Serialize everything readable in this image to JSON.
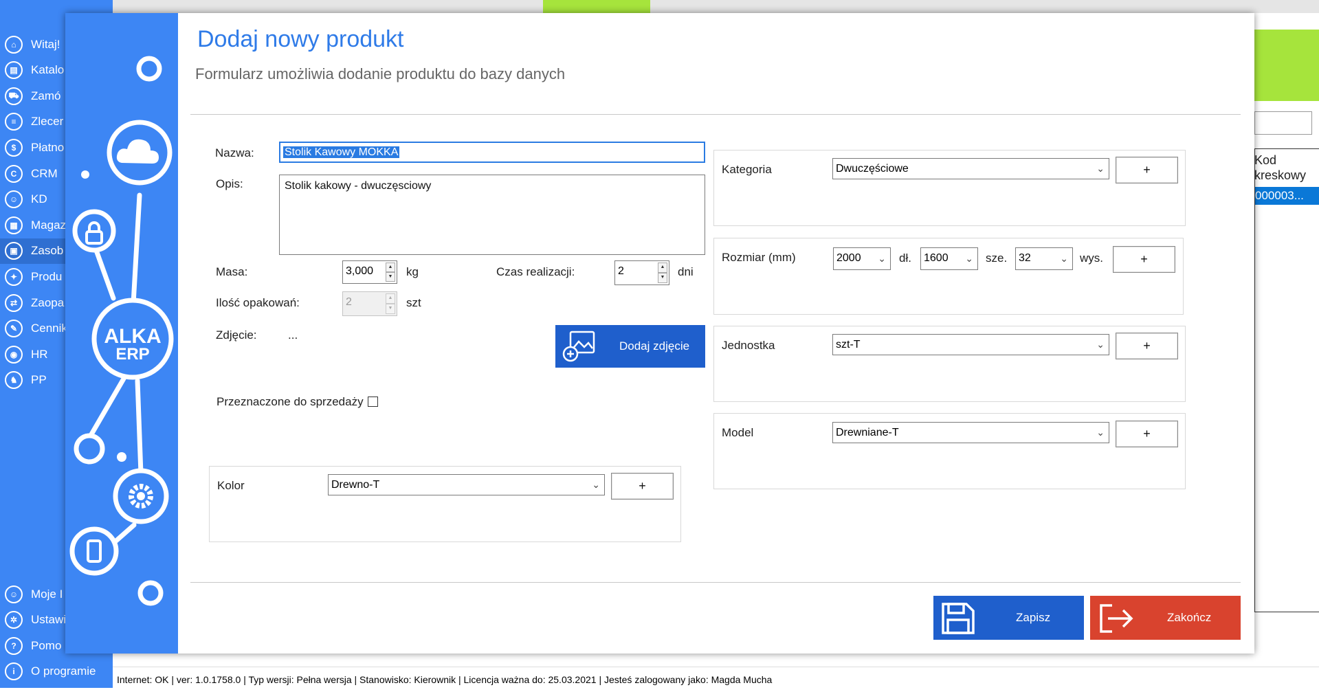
{
  "background": {
    "nav": [
      {
        "label": "Witaj!",
        "icon": "home-icon"
      },
      {
        "label": "Katalo",
        "icon": "book-icon"
      },
      {
        "label": "Zamó",
        "icon": "cart-icon"
      },
      {
        "label": "Zlecer",
        "icon": "list-icon"
      },
      {
        "label": "Płatno",
        "icon": "dollar-icon"
      },
      {
        "label": "CRM",
        "icon": "crm-icon"
      },
      {
        "label": "KD",
        "icon": "person-icon"
      },
      {
        "label": "Magaz",
        "icon": "warehouse-icon"
      },
      {
        "label": "Zasob",
        "icon": "resources-icon"
      },
      {
        "label": "Produ",
        "icon": "production-icon"
      },
      {
        "label": "Zaopa",
        "icon": "supply-icon"
      },
      {
        "label": "Cennik",
        "icon": "tag-icon"
      },
      {
        "label": "HR",
        "icon": "hr-icon"
      },
      {
        "label": "PP",
        "icon": "pp-icon"
      }
    ],
    "nav_bottom": [
      {
        "label": "Moje I",
        "icon": "user-icon"
      },
      {
        "label": "Ustawi",
        "icon": "settings-icon"
      },
      {
        "label": "Pomo",
        "icon": "help-icon"
      },
      {
        "label": "O programie",
        "icon": "info-icon"
      }
    ],
    "grid": {
      "header": "Kod kreskowy",
      "row": "000003..."
    },
    "status_bar": "Internet: OK  |  ver: 1.0.1758.0  |  Typ wersji: Pełna wersja  |  Stanowisko: Kierownik  |  Licencja ważna do: 25.03.2021  |  Jesteś zalogowany jako: Magda Mucha"
  },
  "dialog": {
    "title": "Dodaj nowy produkt",
    "subtitle": "Formularz umożliwia dodanie produktu do bazy danych",
    "logo_line1": "ALKA",
    "logo_line2": "ERP",
    "fields": {
      "name_label": "Nazwa:",
      "name_value": "Stolik Kawowy MOKKA",
      "desc_label": "Opis:",
      "desc_value": "Stolik kakowy - dwuczęsciowy",
      "mass_label": "Masa:",
      "mass_value": "3,000",
      "mass_unit": "kg",
      "time_label": "Czas realizacji:",
      "time_value": "2",
      "time_unit": "dni",
      "packages_label": "Ilość opakowań:",
      "packages_value": "2",
      "packages_unit": "szt",
      "photo_label": "Zdjęcie:",
      "photo_value": "...",
      "add_photo_label": "Dodaj zdjęcie",
      "for_sale_label": "Przeznaczone do sprzedaży",
      "color_label": "Kolor",
      "color_value": "Drewno-T"
    },
    "right": {
      "category_label": "Kategoria",
      "category_value": "Dwuczęściowe",
      "size_label": "Rozmiar (mm)",
      "length_value": "2000",
      "length_unit": "dł.",
      "width_value": "1600",
      "width_unit": "sze.",
      "height_value": "32",
      "height_unit": "wys.",
      "unit_label": "Jednostka",
      "unit_value": "szt-T",
      "model_label": "Model",
      "model_value": "Drewniane-T"
    },
    "plus": "+",
    "save_label": "Zapisz",
    "exit_label": "Zakończ"
  }
}
